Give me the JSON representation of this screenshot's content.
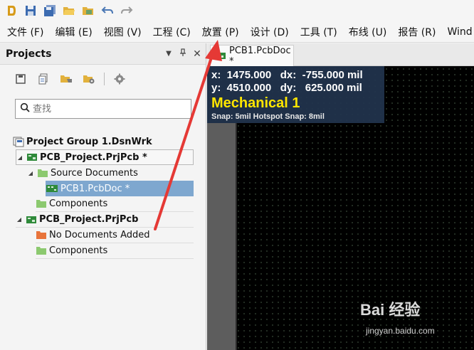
{
  "qat": {
    "icons": [
      "app-logo-icon",
      "save-icon",
      "save-all-icon",
      "open-folder-icon",
      "open-project-icon",
      "undo-icon",
      "redo-icon"
    ]
  },
  "menu": {
    "items": [
      "文件 (F)",
      "编辑 (E)",
      "视图 (V)",
      "工程 (C)",
      "放置 (P)",
      "设计 (D)",
      "工具 (T)",
      "布线 (U)",
      "报告 (R)",
      "Wind"
    ]
  },
  "panel": {
    "title": "Projects",
    "search_placeholder": "查找"
  },
  "tree": {
    "group": "Project Group 1.DsnWrk",
    "project1": "PCB_Project.PrjPcb *",
    "source_docs": "Source Documents",
    "pcb_doc": "PCB1.PcbDoc *",
    "components1": "Components",
    "project2": "PCB_Project.PrjPcb",
    "no_docs": "No Documents Added",
    "components2": "Components"
  },
  "tab": {
    "label": "PCB1.PcbDoc *"
  },
  "hud": {
    "line1": "x:  1475.000   dx:  -755.000 mil",
    "line2": "y:  4510.000   dy:   625.000 mil",
    "layer": "Mechanical 1",
    "snap": "Snap: 5mil Hotspot Snap: 8mil"
  },
  "watermark": {
    "brand": "Bai 经验",
    "url": "jingyan.baidu.com"
  },
  "colors": {
    "accent": "#e53935",
    "hud_bg": "#22344e",
    "layer_text": "#ffe600",
    "selection": "#7ea7cf"
  }
}
